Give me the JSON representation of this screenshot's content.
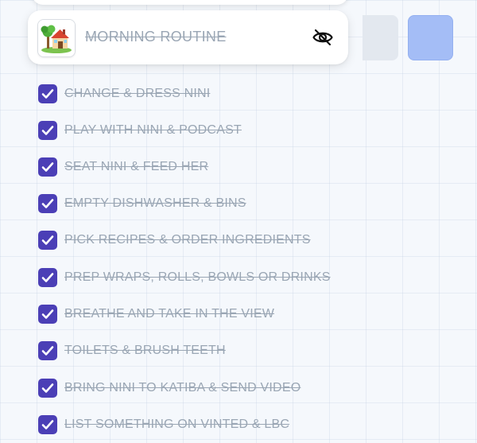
{
  "routine": {
    "title": "MORNING ROUTINE",
    "emoji_icon": "house-with-garden-icon",
    "visibility_icon": "eye-off-icon"
  },
  "colors": {
    "checkbox": "#4b3fb6",
    "completed_text": "#9aa6b4",
    "accent_button": "#a4bdf6",
    "neutral_button": "#e3e8ef",
    "background": "#f5f8fc"
  },
  "tasks": [
    {
      "label": "CHANGE & DRESS NINI",
      "checked": true
    },
    {
      "label": "PLAY WITH NINI & PODCAST",
      "checked": true
    },
    {
      "label": "SEAT NINI & FEED HER",
      "checked": true
    },
    {
      "label": "EMPTY DISHWASHER & BINS",
      "checked": true
    },
    {
      "label": "PICK RECIPES & ORDER INGREDIENTS",
      "checked": true
    },
    {
      "label": "PREP WRAPS, ROLLS, BOWLS OR DRINKS",
      "checked": true
    },
    {
      "label": "BREATHE AND TAKE IN THE VIEW",
      "checked": true
    },
    {
      "label": "TOILETS & BRUSH TEETH",
      "checked": true
    },
    {
      "label": "BRING NINI TO KATIBA & SEND VIDEO",
      "checked": true
    },
    {
      "label": "LIST SOMETHING ON VINTED & LBC",
      "checked": true
    }
  ]
}
